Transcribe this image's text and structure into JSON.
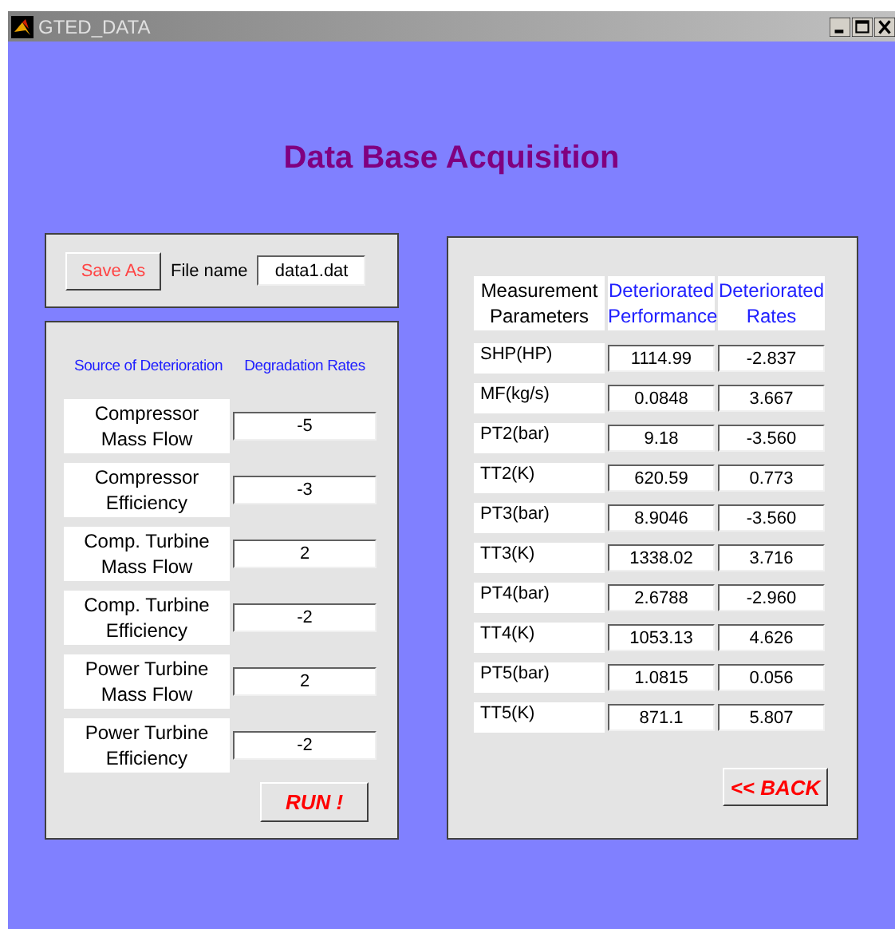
{
  "window": {
    "title": "GTED_DATA"
  },
  "heading": "Data Base Acquisition",
  "save": {
    "button": "Save As",
    "file_label": "File name",
    "file_value": "data1.dat"
  },
  "deterioration": {
    "columns": [
      "Source of Deterioration",
      "Degradation Rates"
    ],
    "rows": [
      {
        "source": "Compressor Mass Flow",
        "rate": "-5"
      },
      {
        "source": "Compressor Efficiency",
        "rate": "-3"
      },
      {
        "source": "Comp. Turbine Mass Flow",
        "rate": "2"
      },
      {
        "source": "Comp. Turbine Efficiency",
        "rate": "-2"
      },
      {
        "source": "Power Turbine Mass Flow",
        "rate": "2"
      },
      {
        "source": "Power Turbine Efficiency",
        "rate": "-2"
      }
    ],
    "run_button": "RUN !"
  },
  "results": {
    "columns": [
      "Measurement Parameters",
      "Deteriorated Performance",
      "Deteriorated Rates"
    ],
    "rows": [
      {
        "parameter": "SHP(HP)",
        "performance": "1114.99",
        "rate": "-2.837"
      },
      {
        "parameter": "MF(kg/s)",
        "performance": "0.0848",
        "rate": "3.667"
      },
      {
        "parameter": "PT2(bar)",
        "performance": "9.18",
        "rate": "-3.560"
      },
      {
        "parameter": "TT2(K)",
        "performance": "620.59",
        "rate": "0.773"
      },
      {
        "parameter": "PT3(bar)",
        "performance": "8.9046",
        "rate": "-3.560"
      },
      {
        "parameter": "TT3(K)",
        "performance": "1338.02",
        "rate": "3.716"
      },
      {
        "parameter": "PT4(bar)",
        "performance": "2.6788",
        "rate": "-2.960"
      },
      {
        "parameter": "TT4(K)",
        "performance": "1053.13",
        "rate": "4.626"
      },
      {
        "parameter": "PT5(bar)",
        "performance": "1.0815",
        "rate": "0.056"
      },
      {
        "parameter": "TT5(K)",
        "performance": "871.1",
        "rate": "5.807"
      }
    ],
    "back_button": "<< BACK"
  }
}
